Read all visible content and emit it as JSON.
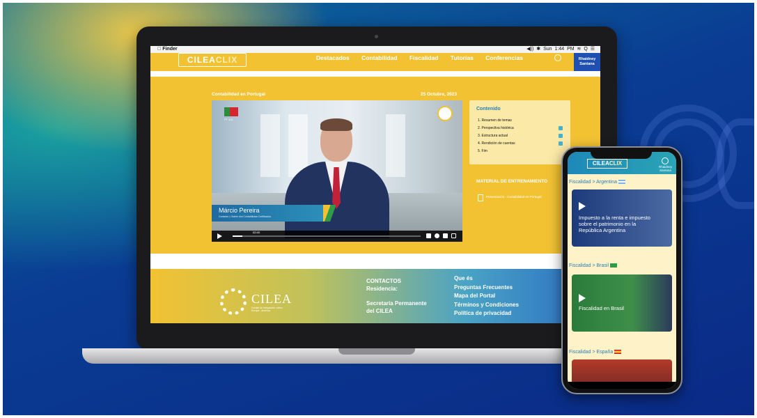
{
  "laptop": {
    "menubar": {
      "app": "Finder",
      "status": "◀)) ✱ Sun 1:44 PM ≋ Q ☰"
    },
    "site": {
      "logo_main": "CILEA",
      "logo_accent": "CLIX",
      "nav": [
        "Destacados",
        "Contabilidad",
        "Fiscalidad",
        "Tutorías",
        "Conferencias"
      ],
      "user_first": "Rhaidney",
      "user_last": "Santana"
    },
    "content": {
      "title": "Contabilidad en Portugal",
      "date": "25 Octubre, 2023",
      "video": {
        "speaker_name": "Márcio Pereira",
        "speaker_subtitle": "Contador | Ordem dos Contabilistas Certificados",
        "flag_label": "PT 101",
        "time": "02:40",
        "progress": 0.05
      },
      "toc": {
        "heading": "Contenido",
        "items": [
          "1. Resumen de temas",
          "2. Perspectiva histórica",
          "3. Estructura actual",
          "4. Rendición de cuentas",
          "5. Fim"
        ]
      },
      "material_heading": "MATERIAL DE ENTRENAMIENTO",
      "material_item": "Presentación - Contabilidad en Portugal"
    },
    "footer": {
      "brand": "CILEA",
      "brand_sub_1": "Comité de Integración Latino",
      "brand_sub_2": "Europa - América",
      "contact_heading": "CONTACTOS",
      "residence_label": "Residencia:",
      "secretariat_1": "Secretaría Permanente",
      "secretariat_2": "del CILEA",
      "links": [
        "Que és",
        "Preguntas Frecuentes",
        "Mapa del Portal",
        "Términos y Condiciones",
        "Política de privacidad"
      ]
    }
  },
  "phone": {
    "logo_main": "CILEA",
    "logo_accent": "CLIX",
    "user_first": "Rhaidney",
    "user_last": "Santana",
    "sections": [
      {
        "breadcrumb": "Fiscalidad > Argentina",
        "card_title": "Impuesto a la renta e impuesto sobre el patrimonio en la República Argentina"
      },
      {
        "breadcrumb": "Fiscalidad > Brasil",
        "card_title": "Fiscalidad en Brasil"
      },
      {
        "breadcrumb": "Fiscalidad > España",
        "card_title": ""
      }
    ]
  },
  "colors": {
    "brand_yellow": "#f2c233",
    "brand_blue": "#1e4fb1",
    "accent_teal": "#2aa4b6"
  }
}
